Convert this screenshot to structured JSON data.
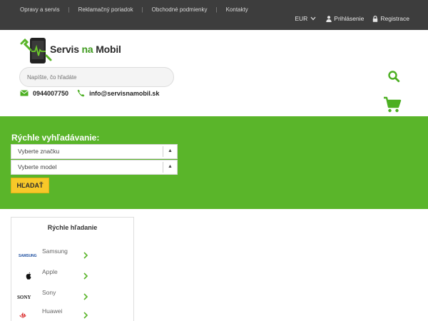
{
  "topbar": {
    "nav": [
      "Opravy a servis",
      "Reklamačný poriadok",
      "Obchodné podmienky",
      "Kontakty"
    ],
    "separator": "|",
    "currency": "EUR",
    "login": "Prihlásenie",
    "register": "Registrace"
  },
  "header": {
    "logo_word_1": "Servis",
    "logo_word_2": "na",
    "logo_word_3": "Mobil",
    "search_placeholder": "Napíšte, čo hľadáte",
    "phone": "0944007750",
    "email": "info@servisnamobil.sk"
  },
  "quick_search": {
    "title": "Rýchle vyhľadávanie:",
    "brand_select": "Vyberte značku",
    "model_select": "Vyberte model",
    "arrow": "▲",
    "button": "HĽADAŤ"
  },
  "sidebar": {
    "title": "Rýchle hľadanie",
    "brands": [
      {
        "name": "Samsung",
        "logo": "SAMSUNG"
      },
      {
        "name": "Apple",
        "logo": "apple-logo-icon"
      },
      {
        "name": "Sony",
        "logo": "SONY"
      },
      {
        "name": "Huawei",
        "logo": "huawei-logo-icon"
      }
    ]
  },
  "colors": {
    "topbar": "#3d3d3d",
    "brand_green": "#5ab52a",
    "button_yellow": "#f7c829"
  }
}
